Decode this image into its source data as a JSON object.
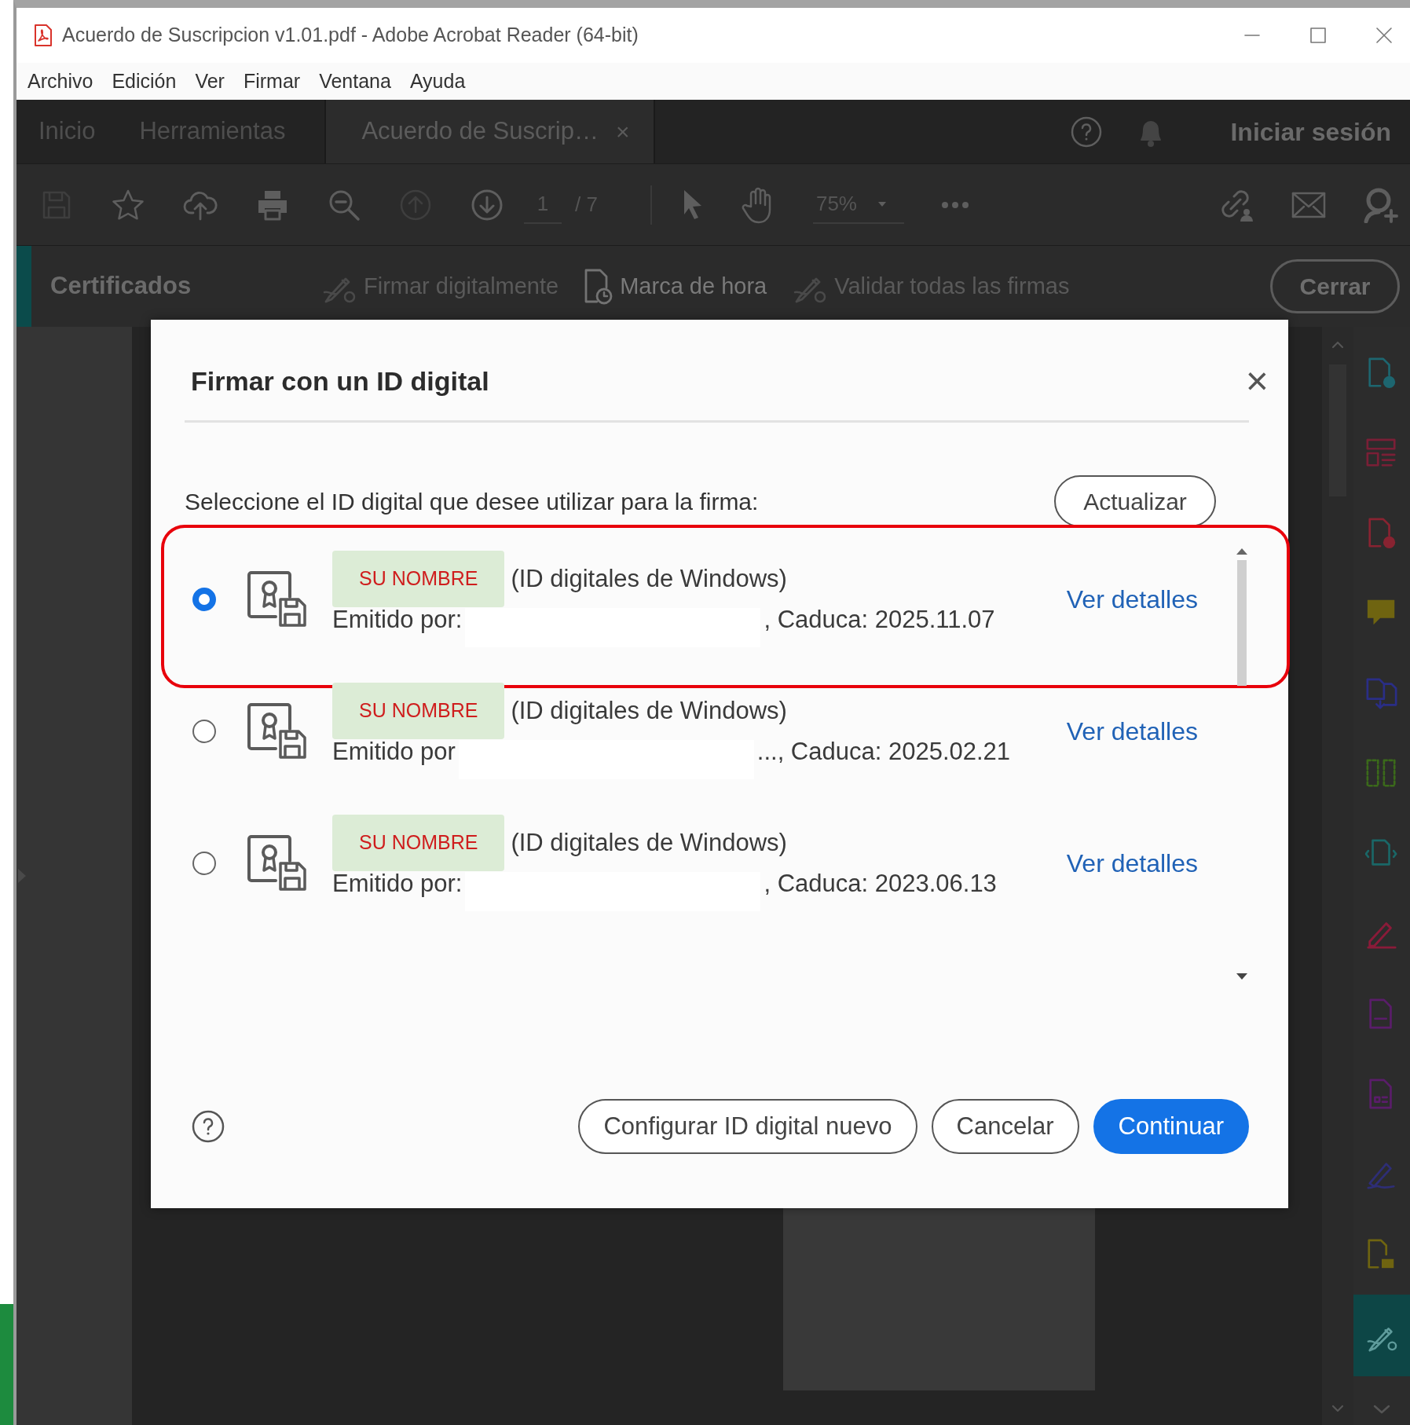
{
  "window": {
    "title": "Acuerdo de Suscripcion v1.01.pdf - Adobe Acrobat Reader (64-bit)"
  },
  "menu": [
    {
      "label": "Archivo"
    },
    {
      "label": "Edición"
    },
    {
      "label": "Ver"
    },
    {
      "label": "Firmar"
    },
    {
      "label": "Ventana"
    },
    {
      "label": "Ayuda"
    }
  ],
  "tabs": [
    {
      "label": "Inicio",
      "kind": "home",
      "selected": false
    },
    {
      "label": "Herramientas",
      "kind": "home",
      "selected": false
    },
    {
      "label": "Acuerdo de Suscrip…",
      "kind": "document",
      "selected": true,
      "close": "×"
    }
  ],
  "sign_in": "Iniciar sesión",
  "toolbar": {
    "page_number": "1",
    "page_count": "/ 7",
    "zoom": "75%"
  },
  "certificates_bar": {
    "title": "Certificados",
    "actions": [
      {
        "label": "Firmar digitalmente",
        "disabled": true
      },
      {
        "label": "Marca de hora",
        "disabled": false
      },
      {
        "label": "Validar todas las firmas",
        "disabled": true
      }
    ],
    "close_button": "Cerrar"
  },
  "side_tools": [
    {
      "selected": false
    },
    {
      "selected": false
    },
    {
      "selected": false
    },
    {
      "selected": false
    },
    {
      "selected": false
    },
    {
      "selected": false
    },
    {
      "selected": false
    },
    {
      "selected": false
    },
    {
      "selected": false
    },
    {
      "selected": false
    },
    {
      "selected": false
    },
    {
      "selected": false
    },
    {
      "selected": true
    }
  ],
  "dialog": {
    "title": "Firmar con un ID digital",
    "close": "×",
    "prompt": "Seleccione el ID digital que desee utilizar para la firma:",
    "refresh_button": "Actualizar",
    "ids": [
      {
        "name_tag": "SU NOMBRE",
        "source": "(ID digitales de Windows)",
        "issued_by": "Emitido por:",
        "expiry": ", Caduca: 2025.11.07",
        "details_link": "Ver detalles",
        "selected": true,
        "highlighted": true
      },
      {
        "name_tag": "SU NOMBRE",
        "source": "(ID digitales de Windows)",
        "issued_by": "Emitido por",
        "expiry": "..., Caduca: 2025.02.21",
        "details_link": "Ver detalles",
        "selected": false,
        "highlighted": false
      },
      {
        "name_tag": "SU NOMBRE",
        "source": "(ID digitales de Windows)",
        "issued_by": "Emitido por:",
        "expiry": ", Caduca: 2023.06.13",
        "details_link": "Ver detalles",
        "selected": false,
        "highlighted": false
      }
    ],
    "buttons": [
      {
        "label": "Configurar ID digital nuevo",
        "kind": "secondary"
      },
      {
        "label": "Cancelar",
        "kind": "secondary"
      },
      {
        "label": "Continuar",
        "kind": "primary"
      }
    ]
  }
}
